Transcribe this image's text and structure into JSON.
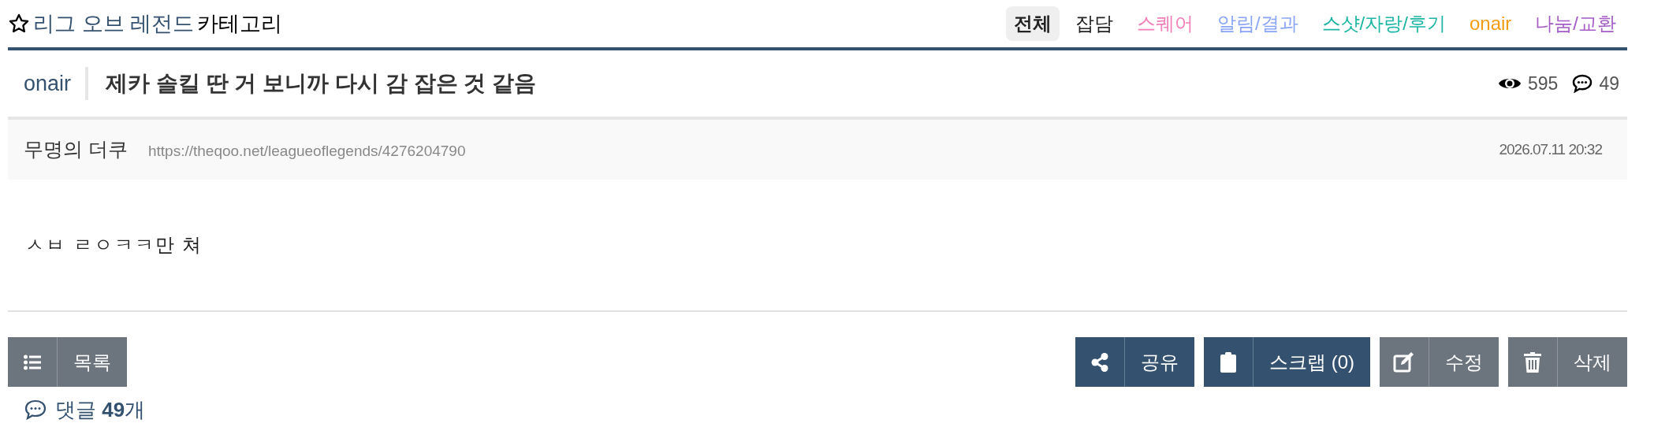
{
  "board": {
    "title": "리그 오브 레전드",
    "suffix": "카테고리"
  },
  "tabs": [
    {
      "label": "전체",
      "selected": true,
      "color": "#222222"
    },
    {
      "label": "잡담",
      "selected": false,
      "color": "#222222"
    },
    {
      "label": "스퀘어",
      "selected": false,
      "color": "#f17fb8"
    },
    {
      "label": "알림/결과",
      "selected": false,
      "color": "#8aa5f6"
    },
    {
      "label": "스샷/자랑/후기",
      "selected": false,
      "color": "#1db5a3"
    },
    {
      "label": "onair",
      "selected": false,
      "color": "#f39c12"
    },
    {
      "label": "나눔/교환",
      "selected": false,
      "color": "#a55cc6"
    }
  ],
  "post": {
    "category": "onair",
    "title": "제카 솔킬 딴 거 보니까 다시 감 잡은 것 같음",
    "views": "595",
    "comments": "49",
    "author": "무명의 더쿠",
    "url": "https://theqoo.net/leagueoflegends/4276204790",
    "date": "2026.07.11 20:32",
    "body": "ㅅㅂ ㄹㅇㅋㅋ만 쳐"
  },
  "left_buttons": [
    {
      "label": "목록",
      "kind": "secondary"
    }
  ],
  "right_buttons": [
    {
      "label": "공유",
      "kind": "primary"
    },
    {
      "label": "스크랩 (0)",
      "kind": "primary"
    },
    {
      "label": "수정",
      "kind": "secondary"
    },
    {
      "label": "삭제",
      "kind": "secondary"
    }
  ],
  "comments_heading": "댓글 **49**개"
}
